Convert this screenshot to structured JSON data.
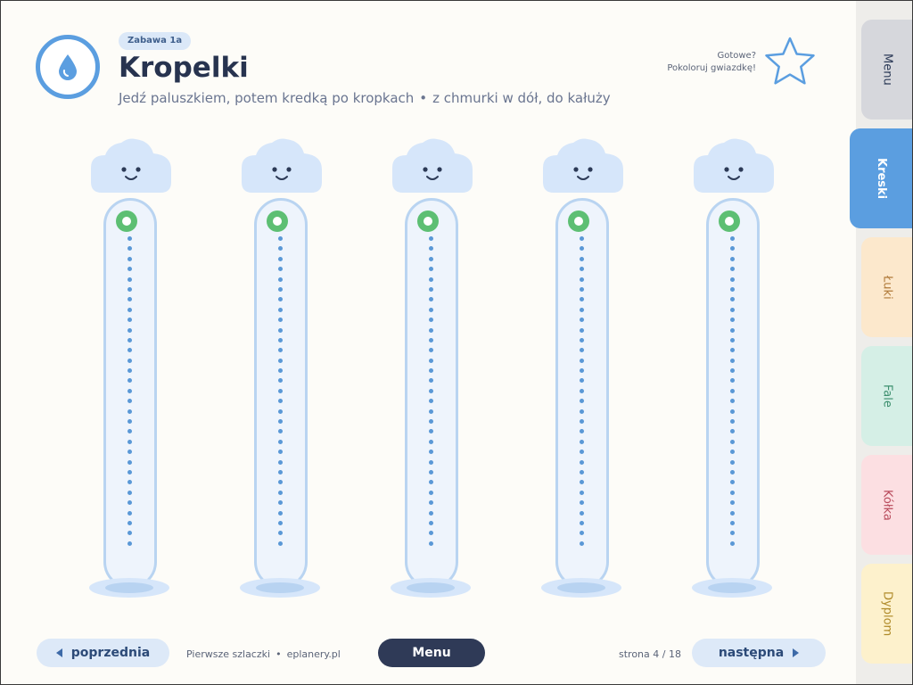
{
  "header": {
    "badge": "Zabawa 1a",
    "title": "Kropelki",
    "subtitle_main": "Jedź paluszkiem, potem kredką po kropkach",
    "subtitle_sep": "•",
    "subtitle_tail": "z chmurki w dół, do kałuży",
    "star_note_line1": "Gotowe?",
    "star_note_line2": "Pokoloruj gwiazdkę!",
    "logo_icon": "water-drop-icon",
    "star_icon": "star-outline-icon"
  },
  "tracks": {
    "count": 5,
    "dots_per_track": 31,
    "start_color": "#5dbf73",
    "dot_color": "#5a98d6",
    "tube_color": "#eef4fc",
    "cloud_color": "#d6e6fa"
  },
  "footer": {
    "prev_label": "poprzednia",
    "menu_label": "Menu",
    "next_label": "następna",
    "brand_left": "Pierwsze szlaczki",
    "brand_sep": "•",
    "brand_right": "eplanery.pl",
    "page_indicator": "strona 4 / 18"
  },
  "sidebar": {
    "tabs": [
      {
        "label": "Menu",
        "bg": "#d6d7dc",
        "fg": "#2c3a57",
        "active": false
      },
      {
        "label": "Kreski",
        "bg": "#5b9ee0",
        "fg": "#ffffff",
        "active": true
      },
      {
        "label": "Łuki",
        "bg": "#fce8cc",
        "fg": "#b07a3a",
        "active": false
      },
      {
        "label": "Fale",
        "bg": "#d5efe6",
        "fg": "#3c8f6e",
        "active": false
      },
      {
        "label": "Kółka",
        "bg": "#fcdfe2",
        "fg": "#b8495a",
        "active": false
      },
      {
        "label": "Dyplom",
        "bg": "#fdf1cc",
        "fg": "#b08b2a",
        "active": false
      }
    ]
  },
  "colors": {
    "accent": "#5b9ee0",
    "dark": "#2f3a57",
    "background": "#fdfcf8"
  }
}
